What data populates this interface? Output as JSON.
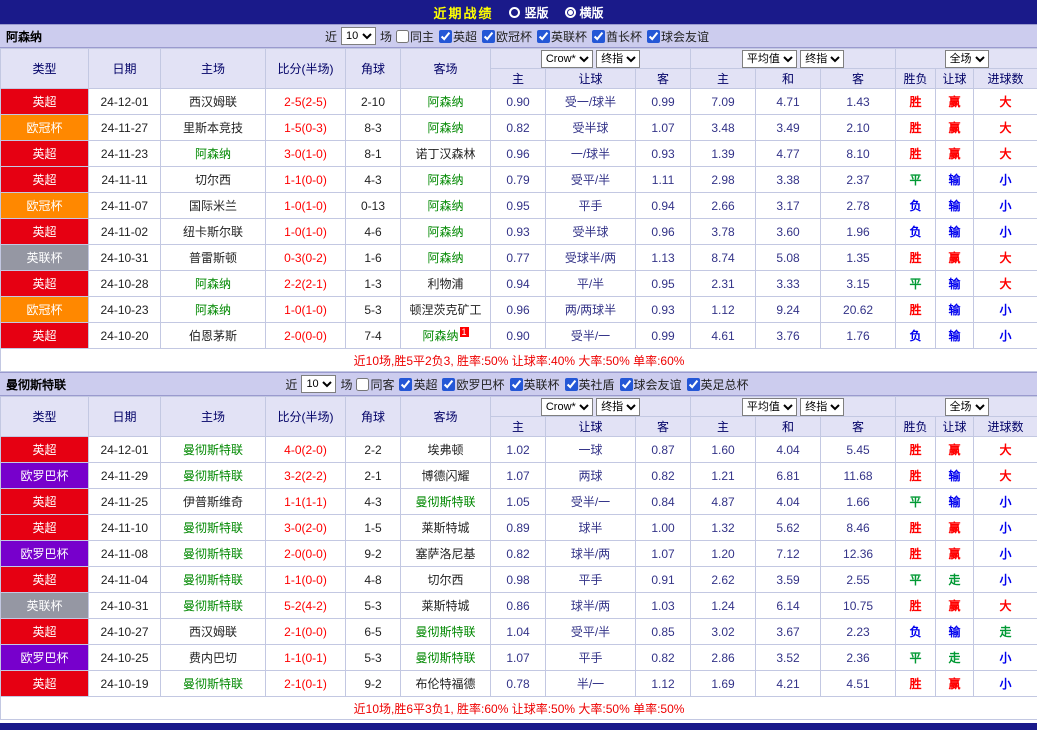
{
  "topbar": {
    "title": "近期战绩",
    "radios": [
      {
        "label": "竖版",
        "selected": false
      },
      {
        "label": "横版",
        "selected": true
      }
    ]
  },
  "columns": {
    "type": "类型",
    "date": "日期",
    "home": "主场",
    "score": "比分(半场)",
    "corner": "角球",
    "away": "客场",
    "odds_home": "主",
    "odds_handicap": "让球",
    "odds_away": "客",
    "avg_home": "主",
    "avg_draw": "和",
    "avg_away": "客",
    "result": "胜负",
    "handicap_result": "让球",
    "goals": "进球数"
  },
  "type_colors": {
    "英超": "#e60012",
    "欧冠杯": "#ff8800",
    "英联杯": "#9597a3",
    "欧罗巴杯": "#7700cc"
  },
  "outcome_colors": {
    "胜": "#ff0000",
    "平": "#009933",
    "负": "#0000ee",
    "赢": "#ff0000",
    "输": "#0000ee",
    "走": "#009933",
    "大": "#ff0000",
    "小": "#0000ee"
  },
  "sections": [
    {
      "team": "阿森纳",
      "filter": {
        "near_label": "近",
        "count": "10",
        "games_label": "场",
        "same": {
          "label": "同主",
          "checked": false
        },
        "leagues": [
          {
            "label": "英超",
            "checked": true
          },
          {
            "label": "欧冠杯",
            "checked": true
          },
          {
            "label": "英联杯",
            "checked": true
          },
          {
            "label": "酋长杯",
            "checked": true
          },
          {
            "label": "球会友谊",
            "checked": true
          }
        ]
      },
      "selectors": {
        "odds_source": "Crow*",
        "odds_time": "终指",
        "avg_source": "平均值",
        "avg_time": "终指",
        "scope": "全场"
      },
      "rows": [
        {
          "type": "英超",
          "date": "24-12-01",
          "home": "西汉姆联",
          "home_focus": false,
          "score": "2-5(2-5)",
          "corner": "2-10",
          "away": "阿森纳",
          "away_focus": true,
          "away_sup": "",
          "odds": [
            "0.90",
            "受一/球半",
            "0.99"
          ],
          "avg": [
            "7.09",
            "4.71",
            "1.43"
          ],
          "result": "胜",
          "handicap": "赢",
          "goals": "大"
        },
        {
          "type": "欧冠杯",
          "date": "24-11-27",
          "home": "里斯本竞技",
          "home_focus": false,
          "score": "1-5(0-3)",
          "corner": "8-3",
          "away": "阿森纳",
          "away_focus": true,
          "away_sup": "",
          "odds": [
            "0.82",
            "受半球",
            "1.07"
          ],
          "avg": [
            "3.48",
            "3.49",
            "2.10"
          ],
          "result": "胜",
          "handicap": "赢",
          "goals": "大"
        },
        {
          "type": "英超",
          "date": "24-11-23",
          "home": "阿森纳",
          "home_focus": true,
          "score": "3-0(1-0)",
          "corner": "8-1",
          "away": "诺丁汉森林",
          "away_focus": false,
          "away_sup": "",
          "odds": [
            "0.96",
            "一/球半",
            "0.93"
          ],
          "avg": [
            "1.39",
            "4.77",
            "8.10"
          ],
          "result": "胜",
          "handicap": "赢",
          "goals": "大"
        },
        {
          "type": "英超",
          "date": "24-11-11",
          "home": "切尔西",
          "home_focus": false,
          "score": "1-1(0-0)",
          "corner": "4-3",
          "away": "阿森纳",
          "away_focus": true,
          "away_sup": "",
          "odds": [
            "0.79",
            "受平/半",
            "1.11"
          ],
          "avg": [
            "2.98",
            "3.38",
            "2.37"
          ],
          "result": "平",
          "handicap": "输",
          "goals": "小"
        },
        {
          "type": "欧冠杯",
          "date": "24-11-07",
          "home": "国际米兰",
          "home_focus": false,
          "score": "1-0(1-0)",
          "corner": "0-13",
          "away": "阿森纳",
          "away_focus": true,
          "away_sup": "",
          "odds": [
            "0.95",
            "平手",
            "0.94"
          ],
          "avg": [
            "2.66",
            "3.17",
            "2.78"
          ],
          "result": "负",
          "handicap": "输",
          "goals": "小"
        },
        {
          "type": "英超",
          "date": "24-11-02",
          "home": "纽卡斯尔联",
          "home_focus": false,
          "score": "1-0(1-0)",
          "corner": "4-6",
          "away": "阿森纳",
          "away_focus": true,
          "away_sup": "",
          "odds": [
            "0.93",
            "受半球",
            "0.96"
          ],
          "avg": [
            "3.78",
            "3.60",
            "1.96"
          ],
          "result": "负",
          "handicap": "输",
          "goals": "小"
        },
        {
          "type": "英联杯",
          "date": "24-10-31",
          "home": "普雷斯顿",
          "home_focus": false,
          "score": "0-3(0-2)",
          "corner": "1-6",
          "away": "阿森纳",
          "away_focus": true,
          "away_sup": "",
          "odds": [
            "0.77",
            "受球半/两",
            "1.13"
          ],
          "avg": [
            "8.74",
            "5.08",
            "1.35"
          ],
          "result": "胜",
          "handicap": "赢",
          "goals": "大"
        },
        {
          "type": "英超",
          "date": "24-10-28",
          "home": "阿森纳",
          "home_focus": true,
          "score": "2-2(2-1)",
          "corner": "1-3",
          "away": "利物浦",
          "away_focus": false,
          "away_sup": "",
          "odds": [
            "0.94",
            "平/半",
            "0.95"
          ],
          "avg": [
            "2.31",
            "3.33",
            "3.15"
          ],
          "result": "平",
          "handicap": "输",
          "goals": "大"
        },
        {
          "type": "欧冠杯",
          "date": "24-10-23",
          "home": "阿森纳",
          "home_focus": true,
          "score": "1-0(1-0)",
          "corner": "5-3",
          "away": "顿涅茨克矿工",
          "away_focus": false,
          "away_sup": "",
          "odds": [
            "0.96",
            "两/两球半",
            "0.93"
          ],
          "avg": [
            "1.12",
            "9.24",
            "20.62"
          ],
          "result": "胜",
          "handicap": "输",
          "goals": "小"
        },
        {
          "type": "英超",
          "date": "24-10-20",
          "home": "伯恩茅斯",
          "home_focus": false,
          "score": "2-0(0-0)",
          "corner": "7-4",
          "away": "阿森纳",
          "away_focus": true,
          "away_sup": "1",
          "odds": [
            "0.90",
            "受半/一",
            "0.99"
          ],
          "avg": [
            "4.61",
            "3.76",
            "1.76"
          ],
          "result": "负",
          "handicap": "输",
          "goals": "小"
        }
      ],
      "summary": "近10场,胜5平2负3, 胜率:50% 让球率:40% 大率:50% 单率:60%"
    },
    {
      "team": "曼彻斯特联",
      "filter": {
        "near_label": "近",
        "count": "10",
        "games_label": "场",
        "same": {
          "label": "同客",
          "checked": false
        },
        "leagues": [
          {
            "label": "英超",
            "checked": true
          },
          {
            "label": "欧罗巴杯",
            "checked": true
          },
          {
            "label": "英联杯",
            "checked": true
          },
          {
            "label": "英社盾",
            "checked": true
          },
          {
            "label": "球会友谊",
            "checked": true
          },
          {
            "label": "英足总杯",
            "checked": true
          }
        ]
      },
      "selectors": {
        "odds_source": "Crow*",
        "odds_time": "终指",
        "avg_source": "平均值",
        "avg_time": "终指",
        "scope": "全场"
      },
      "rows": [
        {
          "type": "英超",
          "date": "24-12-01",
          "home": "曼彻斯特联",
          "home_focus": true,
          "score": "4-0(2-0)",
          "corner": "2-2",
          "away": "埃弗顿",
          "away_focus": false,
          "away_sup": "",
          "odds": [
            "1.02",
            "一球",
            "0.87"
          ],
          "avg": [
            "1.60",
            "4.04",
            "5.45"
          ],
          "result": "胜",
          "handicap": "赢",
          "goals": "大"
        },
        {
          "type": "欧罗巴杯",
          "date": "24-11-29",
          "home": "曼彻斯特联",
          "home_focus": true,
          "score": "3-2(2-2)",
          "corner": "2-1",
          "away": "博德闪耀",
          "away_focus": false,
          "away_sup": "",
          "odds": [
            "1.07",
            "两球",
            "0.82"
          ],
          "avg": [
            "1.21",
            "6.81",
            "11.68"
          ],
          "result": "胜",
          "handicap": "输",
          "goals": "大"
        },
        {
          "type": "英超",
          "date": "24-11-25",
          "home": "伊普斯维奇",
          "home_focus": false,
          "score": "1-1(1-1)",
          "corner": "4-3",
          "away": "曼彻斯特联",
          "away_focus": true,
          "away_sup": "",
          "odds": [
            "1.05",
            "受半/一",
            "0.84"
          ],
          "avg": [
            "4.87",
            "4.04",
            "1.66"
          ],
          "result": "平",
          "handicap": "输",
          "goals": "小"
        },
        {
          "type": "英超",
          "date": "24-11-10",
          "home": "曼彻斯特联",
          "home_focus": true,
          "score": "3-0(2-0)",
          "corner": "1-5",
          "away": "莱斯特城",
          "away_focus": false,
          "away_sup": "",
          "odds": [
            "0.89",
            "球半",
            "1.00"
          ],
          "avg": [
            "1.32",
            "5.62",
            "8.46"
          ],
          "result": "胜",
          "handicap": "赢",
          "goals": "小"
        },
        {
          "type": "欧罗巴杯",
          "date": "24-11-08",
          "home": "曼彻斯特联",
          "home_focus": true,
          "score": "2-0(0-0)",
          "corner": "9-2",
          "away": "塞萨洛尼基",
          "away_focus": false,
          "away_sup": "",
          "odds": [
            "0.82",
            "球半/两",
            "1.07"
          ],
          "avg": [
            "1.20",
            "7.12",
            "12.36"
          ],
          "result": "胜",
          "handicap": "赢",
          "goals": "小"
        },
        {
          "type": "英超",
          "date": "24-11-04",
          "home": "曼彻斯特联",
          "home_focus": true,
          "score": "1-1(0-0)",
          "corner": "4-8",
          "away": "切尔西",
          "away_focus": false,
          "away_sup": "",
          "odds": [
            "0.98",
            "平手",
            "0.91"
          ],
          "avg": [
            "2.62",
            "3.59",
            "2.55"
          ],
          "result": "平",
          "handicap": "走",
          "goals": "小"
        },
        {
          "type": "英联杯",
          "date": "24-10-31",
          "home": "曼彻斯特联",
          "home_focus": true,
          "score": "5-2(4-2)",
          "corner": "5-3",
          "away": "莱斯特城",
          "away_focus": false,
          "away_sup": "",
          "odds": [
            "0.86",
            "球半/两",
            "1.03"
          ],
          "avg": [
            "1.24",
            "6.14",
            "10.75"
          ],
          "result": "胜",
          "handicap": "赢",
          "goals": "大"
        },
        {
          "type": "英超",
          "date": "24-10-27",
          "home": "西汉姆联",
          "home_focus": false,
          "score": "2-1(0-0)",
          "corner": "6-5",
          "away": "曼彻斯特联",
          "away_focus": true,
          "away_sup": "",
          "odds": [
            "1.04",
            "受平/半",
            "0.85"
          ],
          "avg": [
            "3.02",
            "3.67",
            "2.23"
          ],
          "result": "负",
          "handicap": "输",
          "goals": "走"
        },
        {
          "type": "欧罗巴杯",
          "date": "24-10-25",
          "home": "费内巴切",
          "home_focus": false,
          "score": "1-1(0-1)",
          "corner": "5-3",
          "away": "曼彻斯特联",
          "away_focus": true,
          "away_sup": "",
          "odds": [
            "1.07",
            "平手",
            "0.82"
          ],
          "avg": [
            "2.86",
            "3.52",
            "2.36"
          ],
          "result": "平",
          "handicap": "走",
          "goals": "小"
        },
        {
          "type": "英超",
          "date": "24-10-19",
          "home": "曼彻斯特联",
          "home_focus": true,
          "score": "2-1(0-1)",
          "corner": "9-2",
          "away": "布伦特福德",
          "away_focus": false,
          "away_sup": "",
          "odds": [
            "0.78",
            "半/一",
            "1.12"
          ],
          "avg": [
            "1.69",
            "4.21",
            "4.51"
          ],
          "result": "胜",
          "handicap": "赢",
          "goals": "小"
        }
      ],
      "summary": "近10场,胜6平3负1, 胜率:60% 让球率:50% 大率:50% 单率:50%"
    }
  ]
}
